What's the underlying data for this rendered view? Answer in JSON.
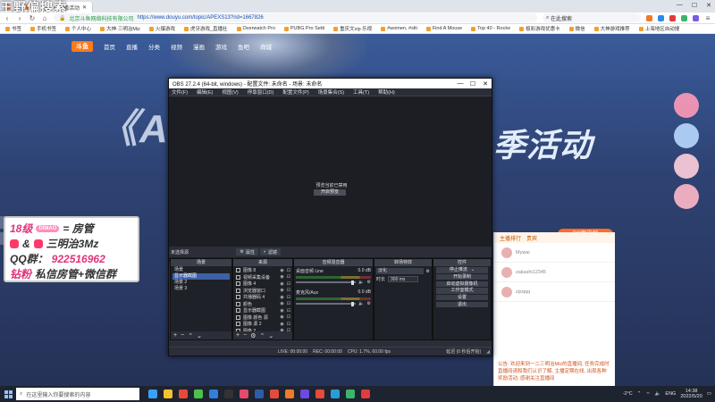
{
  "browser": {
    "overlay_title": "王野偏搜索",
    "tabs": [
      {
        "label": "",
        "active": false
      },
      {
        "label": "",
        "active": false
      },
      {
        "label": "户气播活动",
        "active": true
      }
    ],
    "address": {
      "site_name": "北京斗鱼网络科技有限公司",
      "url": "https://www.douyu.com/topic/APEXS13?rid=1667826"
    },
    "search_text": "在此搜索",
    "bookmarks": [
      "书签",
      "手机书签",
      "个人中心",
      "大神·三明治Miz",
      "火爆游戏",
      "虎牙游戏_直播社",
      "Overwatch Pro",
      "PUBG Pro Setti",
      "重庆文vip 乐视",
      "#women, #slti",
      "Find A Mouse",
      "Top 40 - Rocke",
      "极彩游戏优惠卡",
      "微信",
      "大神游戏推荐",
      "上海地区自动搜"
    ]
  },
  "page": {
    "nav": [
      "斗鱼",
      "首页",
      "直播",
      "分类",
      "视频",
      "漫画",
      "游戏",
      "鱼吧",
      "商城"
    ],
    "banner_left": "《APE",
    "banner_right": "季活动",
    "pc_button": "PC客户端",
    "chat_tabs": [
      "主播排行",
      "贵宾"
    ],
    "chat_names": [
      "Mywai",
      "zakashi12345",
      "zjsqqq"
    ],
    "chat_message": "公告: 欢迎来到一二三明治Miz的直播间, 任务完成时直播间请和我们认识了解, 主播定期在线, 出现各种奖励活动, 感谢关注直播间"
  },
  "sticker": {
    "line1_level": "18级",
    "line1_badge": "DIMAO",
    "line1_text": "= 房管",
    "line2_text": "三明治3Mz",
    "line3_label": "QQ群：",
    "line3_value": "922516962",
    "line4_label": "钻粉",
    "line4_text": "私信房管+微信群"
  },
  "obs": {
    "title": "OBS 27.2.4 (64-bit, windows) - 配置文件: 未命名 - 场景: 未命名",
    "menu": [
      "文件(F)",
      "编辑(E)",
      "视图(V)",
      "停靠窗口(D)",
      "配置文件(P)",
      "场景集合(S)",
      "工具(T)",
      "帮助(H)"
    ],
    "preview_msg": "预览当前已禁用",
    "preview_btn": "开启预览",
    "ctrl_left": "未选择源",
    "ctrl_props": "属性",
    "ctrl_filters": "滤镜",
    "docks": {
      "scenes": {
        "title": "场景",
        "items": [
          "场景",
          "显示器截图",
          "场景 2",
          "场景 3"
        ],
        "selected": 1
      },
      "sources": {
        "title": "来源",
        "items": [
          "图像 8",
          "视频采集设备",
          "图像 4",
          "浏览器窗口",
          "共播器码 4",
          "颜色",
          "显示器截图",
          "图像 颜色 源",
          "图像 源 2",
          "图像 2"
        ]
      },
      "mixer": {
        "title": "音频混音器",
        "channels": [
          {
            "name": "桌面音频 Line",
            "db": "0.0 dB"
          },
          {
            "name": "麦克风/Aux",
            "db": "0.0 dB"
          }
        ]
      },
      "transitions": {
        "title": "转场特效",
        "type": "淡化",
        "duration_label": "时长",
        "duration": "300 ms"
      },
      "controls": {
        "title": "控件",
        "buttons": [
          "停止推流",
          "开始录制",
          "启动虚拟摄像机",
          "工作室模式",
          "设置",
          "退出"
        ]
      }
    },
    "status": {
      "live": "LIVE: 00:00:00",
      "rec": "REC: 00:00:00",
      "cpu": "CPU: 1.7%, 60.00 fps",
      "dropped": "丢帧 0 (0.0%)",
      "bitrate": "延迟 (0 秒后开始)"
    }
  },
  "taskbar": {
    "search_placeholder": "在这里输入你要搜索的内容",
    "weather": "-2°C",
    "lang": "ENG",
    "time": "14:38",
    "date": "2022/5/20"
  },
  "colors": {
    "obs_bg": "#2b2e38",
    "obs_dark": "#1f2128",
    "accent_orange": "#ff6a2c",
    "sticker_pink": "#e0337a",
    "taskbar": "#1e2330"
  }
}
